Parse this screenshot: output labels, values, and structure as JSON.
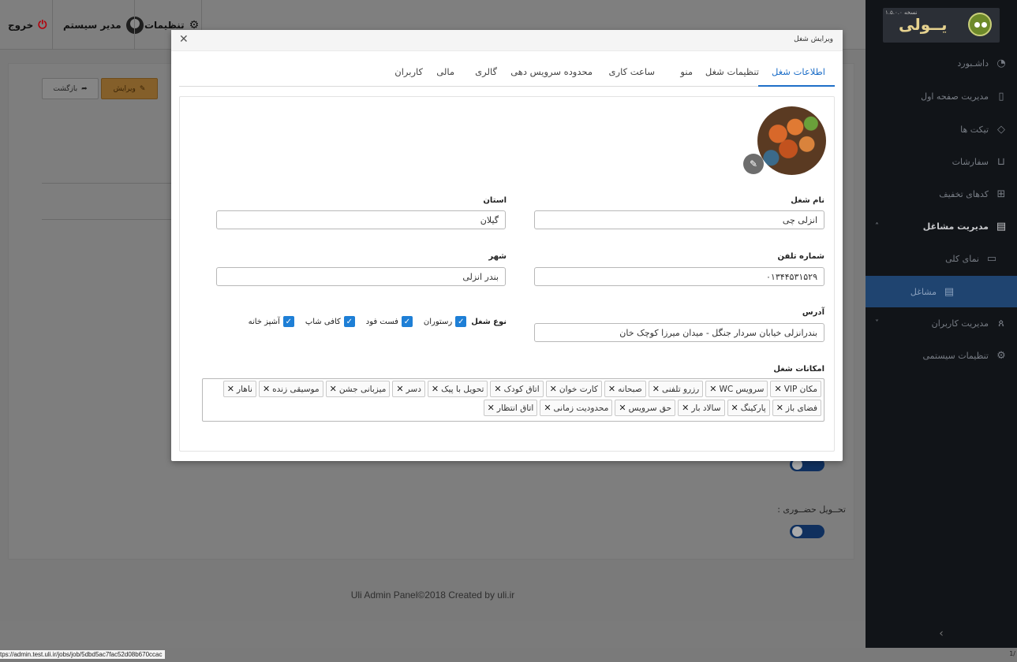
{
  "topbar": {
    "logout_label": "خروج",
    "user_label": "مدیر سیستم",
    "settings_label": "تنظیمات"
  },
  "page": {
    "edit_label": "ویرایش",
    "back_label": "بازگشت",
    "delivery_label": "تحــویل حضــوری :",
    "footer_text": "Uli Admin Panel©2018 Created by uli.ir"
  },
  "sidebar": {
    "version": "نسخه ۱.۵.۰.۰",
    "logo_text": "یــولی",
    "items": [
      {
        "label": "داشـبورد",
        "icon": "gauge-icon"
      },
      {
        "label": "مدیریت صفحه اول",
        "icon": "page-icon"
      },
      {
        "label": "تیکت ها",
        "icon": "tag-icon"
      },
      {
        "label": "سفارشات",
        "icon": "cart-icon"
      },
      {
        "label": "کدهای تخفیف",
        "icon": "gift-icon"
      },
      {
        "label": "مدیریت مشاغل",
        "icon": "store-icon"
      },
      {
        "label": "نمای کلی",
        "icon": "monitor-icon"
      },
      {
        "label": "مشاغل",
        "icon": "store-icon"
      },
      {
        "label": "مدیریت کاربران",
        "icon": "users-icon"
      },
      {
        "label": "تنظیمات سیستمی",
        "icon": "gear-icon"
      }
    ]
  },
  "modal": {
    "title": "ویرایش شغل",
    "tabs": [
      "اطلاعات شغل",
      "تنظیمات شغل",
      "منو",
      "ساعت کاری",
      "محدوده سرویس دهی",
      "گالری",
      "مالی",
      "کاربران"
    ],
    "active_tab": "اطلاعات شغل",
    "fields": {
      "name_label": "نام شغل",
      "name_value": "انزلی چی",
      "province_label": "استان",
      "province_value": "گیلان",
      "phone_label": "شماره تلفن",
      "phone_value": "۰۱۳۴۴۵۳۱۵۲۹",
      "city_label": "شهر",
      "city_value": "بندر انزلی",
      "address_label": "آدرس",
      "address_value": "بندرانزلی خیابان سردار جنگل - میدان میرزا کوچک خان",
      "type_label": "نوع شغل",
      "types": [
        "رستوران",
        "فست فود",
        "کافی شاپ",
        "آشپز خانه"
      ],
      "features_label": "امکانات شغل",
      "features": [
        "مکان VIP",
        "سرویس WC",
        "رزرو تلفنی",
        "صبحانه",
        "کارت خوان",
        "اتاق کودک",
        "تحویل با پیک",
        "دسر",
        "میزبانی جشن",
        "موسیقی زنده",
        "ناهار",
        "فضای باز",
        "پارکینگ",
        "سالاد بار",
        "حق سرویس",
        "محدودیت زمانی",
        "اتاق انتظار"
      ]
    }
  },
  "status_bar": {
    "url": "tps://admin.test.uli.ir/jobs/job/5dbd5ac7fac52d08b670ccac",
    "page": "1/"
  }
}
